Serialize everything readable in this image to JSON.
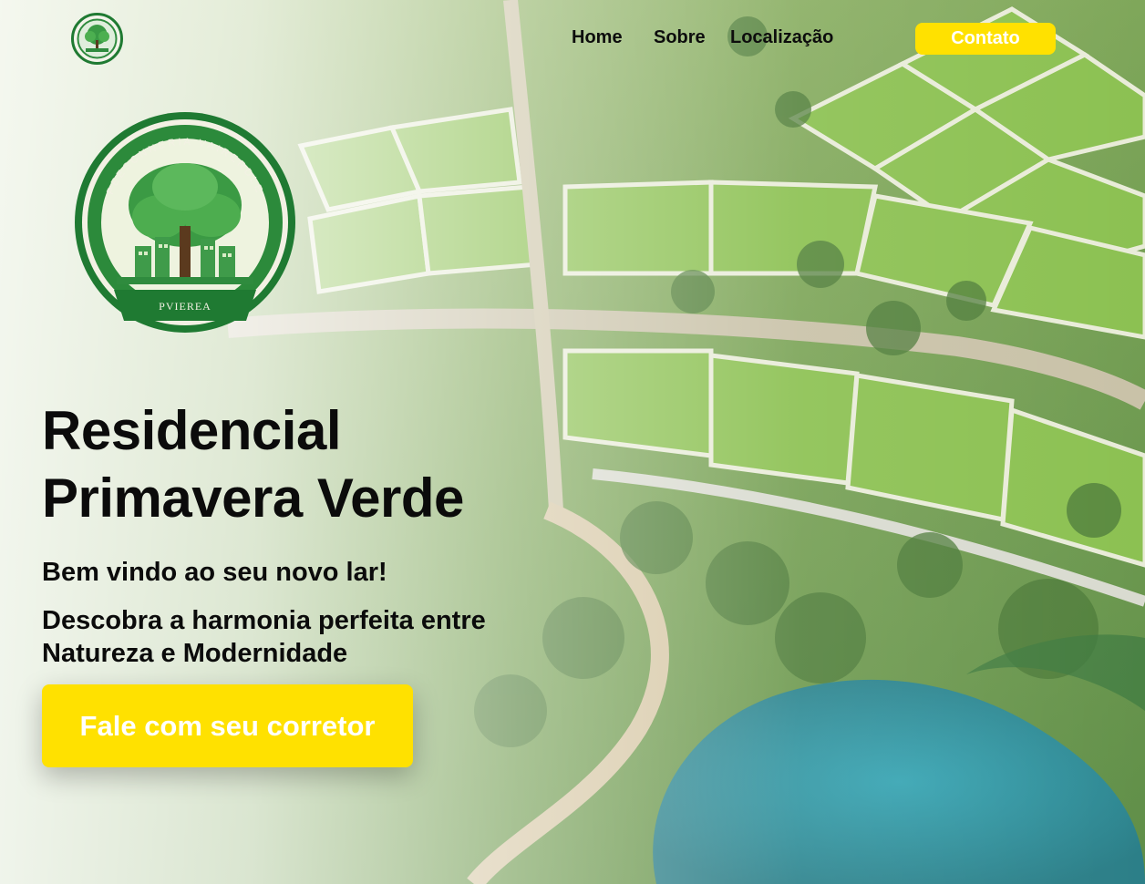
{
  "nav": {
    "logo_icon": "tree-seal-logo-icon",
    "links": [
      {
        "label": "Home"
      },
      {
        "label": "Sobre"
      },
      {
        "label": "Localização"
      }
    ],
    "contact_label": "Contato"
  },
  "hero": {
    "logo_icon": "tree-seal-emblem-icon",
    "logo_text_top": "PEESCNNERIA VAIRERDLE",
    "logo_text_bottom": "PVIEREA",
    "title_line1": "Residencial",
    "title_line2": "Primavera Verde",
    "welcome": "Bem vindo ao seu novo lar!",
    "description": "Descobra a harmonia perfeita entre Natureza e Modernidade",
    "cta_label": "Fale com seu corretor"
  },
  "colors": {
    "accent": "#ffe100",
    "text": "#0b0b0b",
    "logo_green": "#1f7a32"
  }
}
